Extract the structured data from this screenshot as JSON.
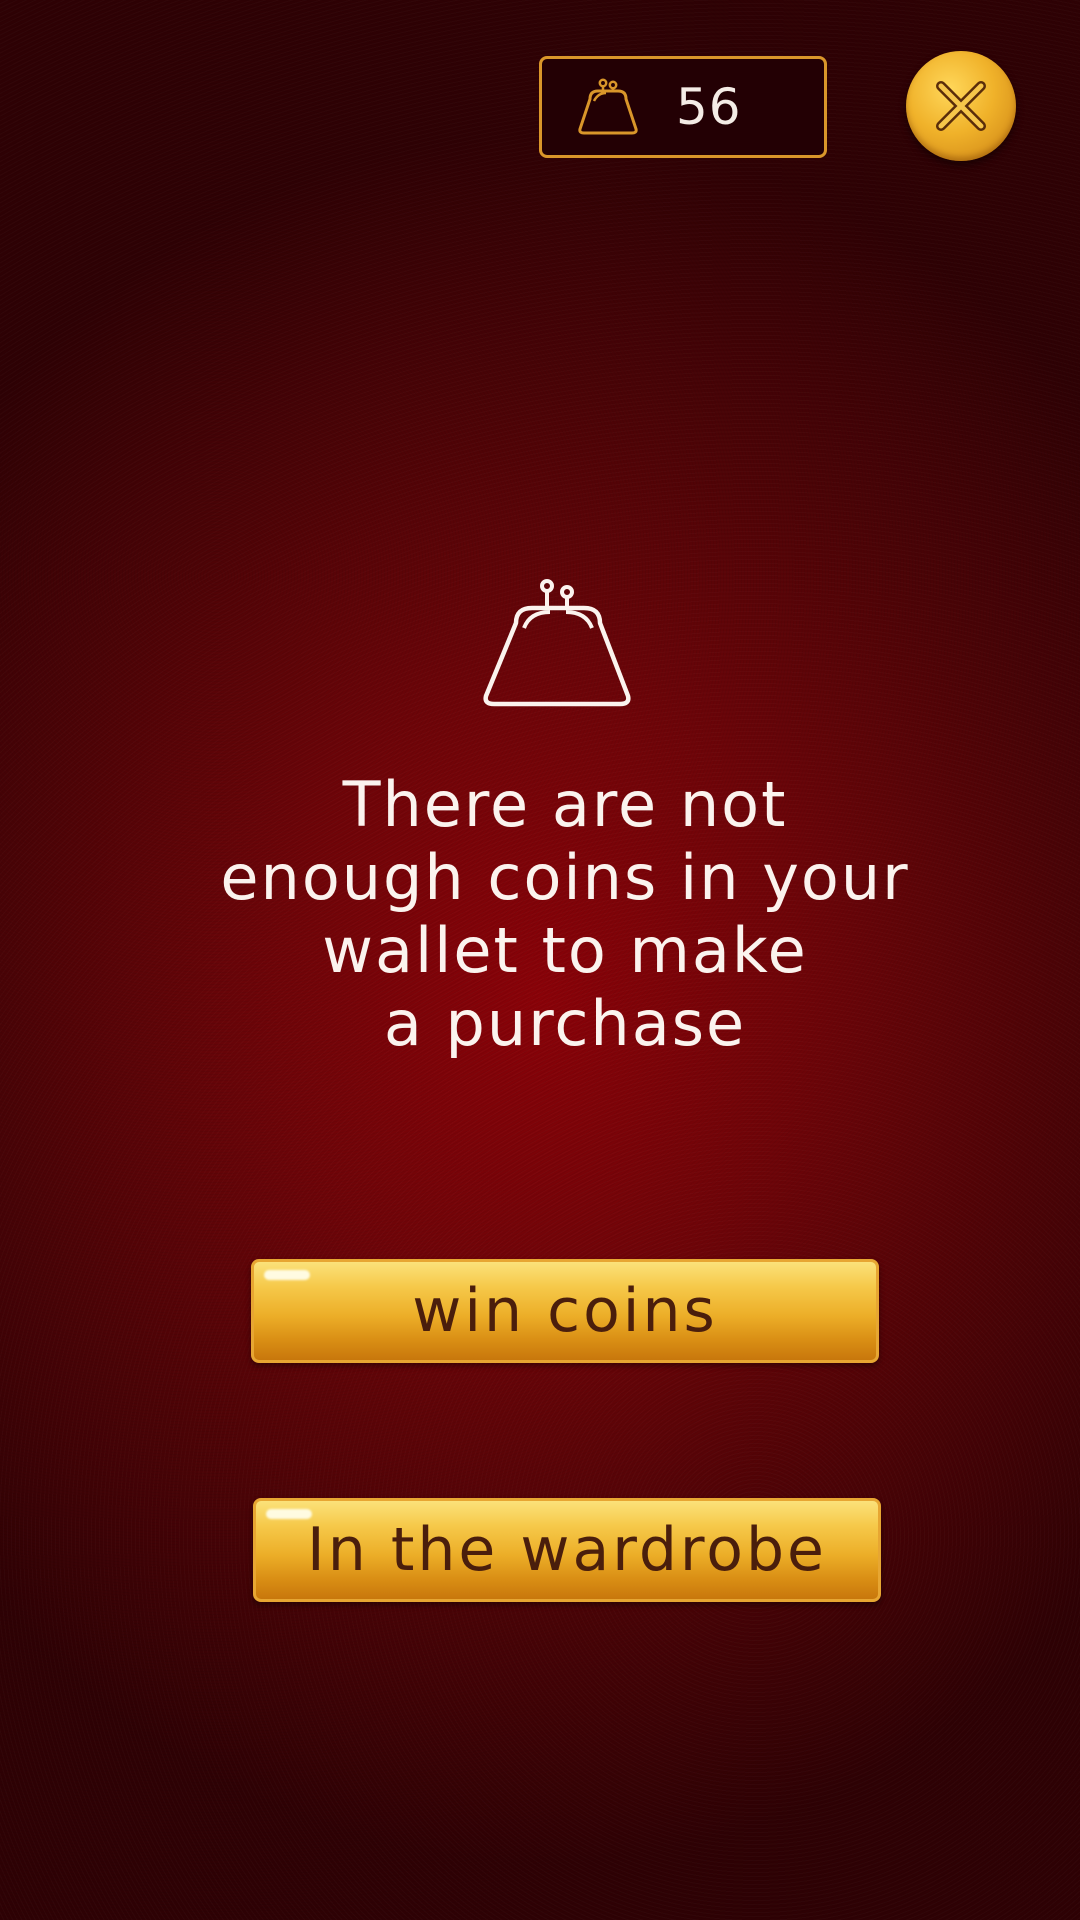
{
  "wallet": {
    "coin_count": "56",
    "icon": "purse-icon"
  },
  "close_button": {
    "icon": "close-icon"
  },
  "message": {
    "icon": "purse-icon",
    "line1": "There are not",
    "line2": "enough coins in your",
    "line3": "wallet to make",
    "line4": "a purchase"
  },
  "actions": {
    "win_coins_label": "win coins",
    "wardrobe_label": "In the wardrobe"
  },
  "colors": {
    "background": "#7a0208",
    "gold": "#f0b22a",
    "button_text": "#4a1e0c",
    "text": "#fbf3ee"
  }
}
